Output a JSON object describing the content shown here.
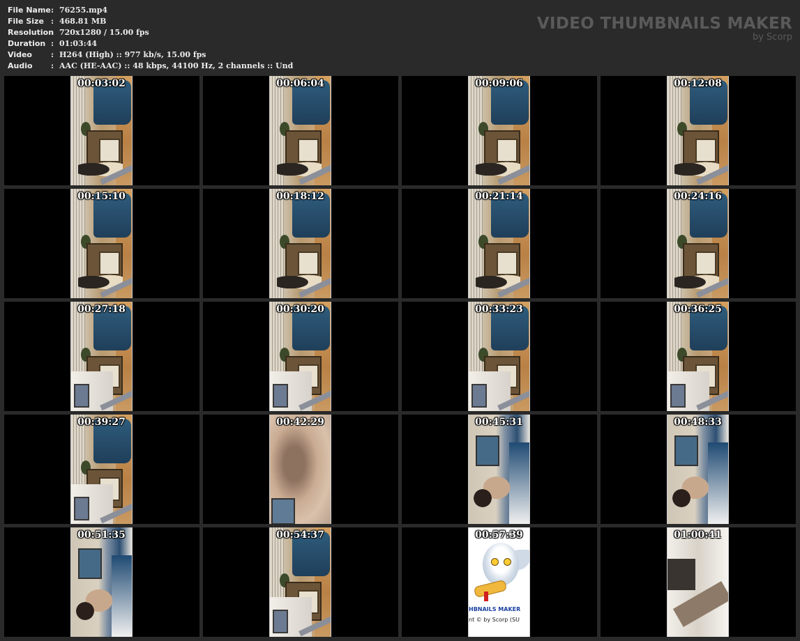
{
  "info": [
    {
      "label": "File Name",
      "sep": ":",
      "value": "76255.mp4"
    },
    {
      "label": "File Size",
      "sep": ":",
      "value": "468.81 MB"
    },
    {
      "label": "Resolution",
      "sep": ":",
      "value": "720x1280 / 15.00 fps"
    },
    {
      "label": "Duration",
      "sep": ":",
      "value": "01:03:44"
    },
    {
      "label": "Video",
      "sep": ":",
      "value": "H264 (High) :: 977 kb/s, 15.00 fps"
    },
    {
      "label": "Audio",
      "sep": ":",
      "value": "AAC (HE-AAC) :: 48 kbps, 44100 Hz, 2 channels :: Und"
    }
  ],
  "brand": {
    "title": "VIDEO THUMBNAILS MAKER",
    "subtitle": "by Scorp"
  },
  "thumbnails": [
    {
      "time": "00:03:02",
      "scene": "room"
    },
    {
      "time": "00:06:04",
      "scene": "room"
    },
    {
      "time": "00:09:06",
      "scene": "room"
    },
    {
      "time": "00:12:08",
      "scene": "room"
    },
    {
      "time": "00:15:10",
      "scene": "room"
    },
    {
      "time": "00:18:12",
      "scene": "room"
    },
    {
      "time": "00:21:14",
      "scene": "room"
    },
    {
      "time": "00:24:16",
      "scene": "room"
    },
    {
      "time": "00:27:18",
      "scene": "room-bed"
    },
    {
      "time": "00:30:20",
      "scene": "room-bed"
    },
    {
      "time": "00:33:23",
      "scene": "room-bed"
    },
    {
      "time": "00:36:25",
      "scene": "room-bed"
    },
    {
      "time": "00:39:27",
      "scene": "room-bed"
    },
    {
      "time": "00:42:29",
      "scene": "skin"
    },
    {
      "time": "00:45:31",
      "scene": "bedroom"
    },
    {
      "time": "00:48:33",
      "scene": "bedroom"
    },
    {
      "time": "00:51:35",
      "scene": "bedroom"
    },
    {
      "time": "00:54:37",
      "scene": "room-bed"
    },
    {
      "time": "00:57:39",
      "scene": "logo",
      "logo_line1": "HBNAILS MAKER",
      "logo_line2": "nt © by Scorp (SU"
    },
    {
      "time": "01:00:41",
      "scene": "white"
    }
  ],
  "colors": {
    "background": "#2a2a2a",
    "cell": "#000000",
    "info_text": "#ececec",
    "brand_text": "#5a5a5a"
  }
}
